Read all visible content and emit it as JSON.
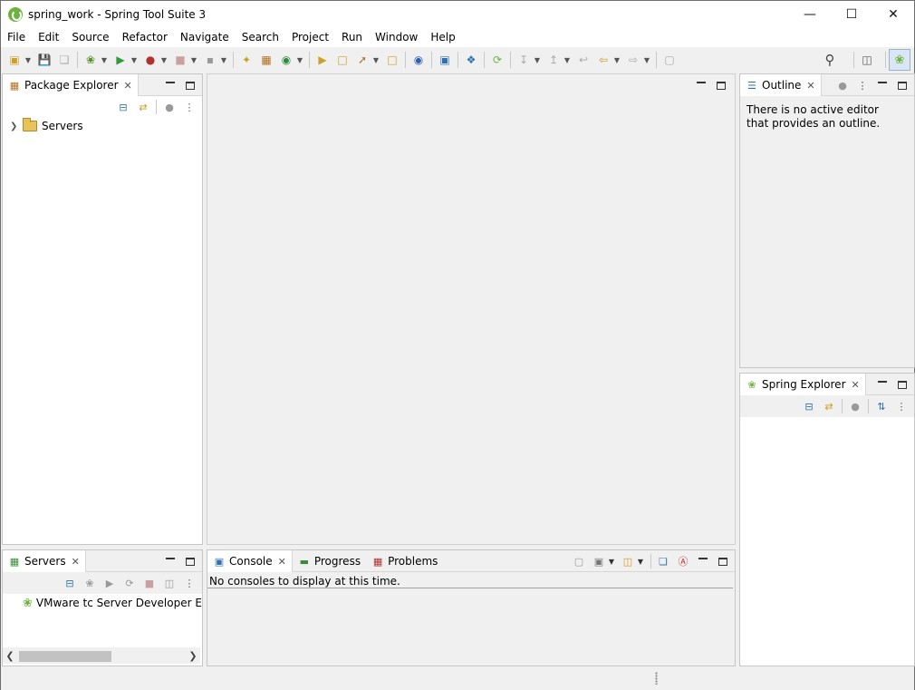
{
  "window": {
    "title": "spring_work - Spring Tool Suite 3"
  },
  "menubar": {
    "items": [
      "File",
      "Edit",
      "Source",
      "Refactor",
      "Navigate",
      "Search",
      "Project",
      "Run",
      "Window",
      "Help"
    ]
  },
  "package_explorer": {
    "tab_label": "Package Explorer",
    "tree": [
      {
        "label": "Servers",
        "icon": "folder-icon",
        "expanded": false
      }
    ]
  },
  "outline": {
    "tab_label": "Outline",
    "message": "There is no active editor that provides an outline."
  },
  "spring_explorer": {
    "tab_label": "Spring Explorer"
  },
  "servers": {
    "tab_label": "Servers",
    "items": [
      {
        "label": "VMware tc Server Developer Edit",
        "icon": "tc-server-icon"
      }
    ]
  },
  "bottom_panel": {
    "tabs": [
      {
        "label": "Console",
        "icon": "console-icon",
        "active": true
      },
      {
        "label": "Progress",
        "icon": "progress-icon",
        "active": false
      },
      {
        "label": "Problems",
        "icon": "problems-icon",
        "active": false
      }
    ],
    "console_message": "No consoles to display at this time."
  },
  "colors": {
    "spring_green": "#6db33f",
    "selection_blue": "#dbe6f4"
  }
}
